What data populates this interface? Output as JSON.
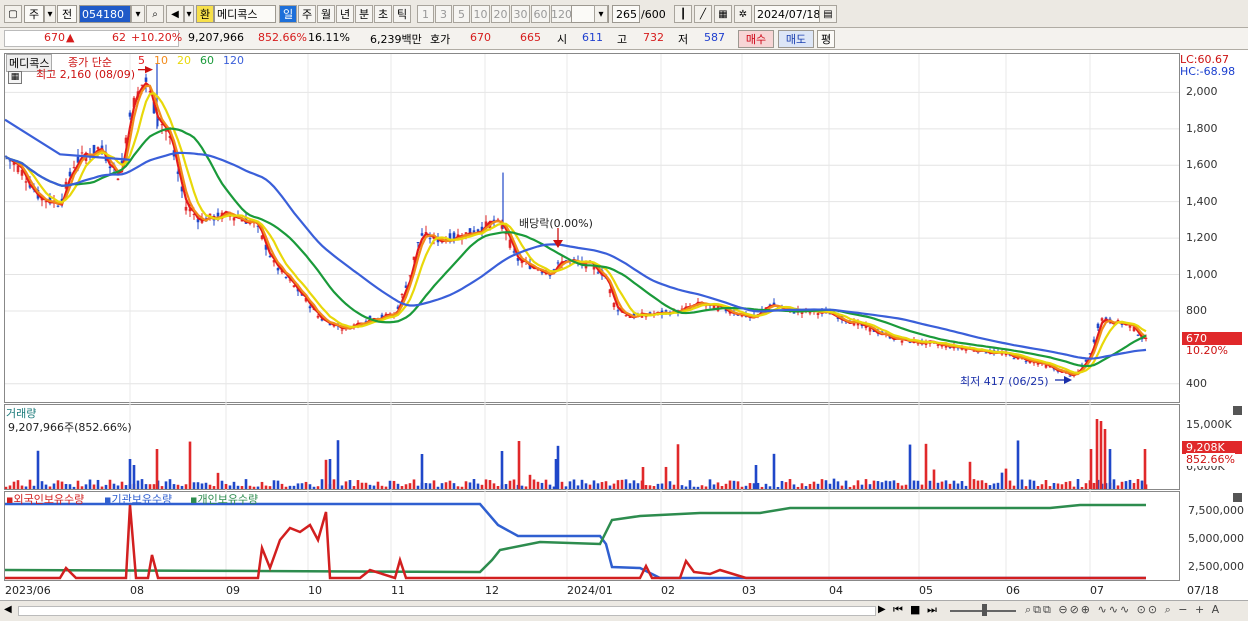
{
  "toolbar": {
    "chart_type_1": "주",
    "chart_type_2": "전",
    "code": "054180",
    "currency": "환",
    "stock_name": "메디콕스",
    "periods": [
      "일",
      "주",
      "월",
      "년",
      "분",
      "초",
      "틱"
    ],
    "selected_period": "일",
    "intervals": [
      "1",
      "3",
      "5",
      "10",
      "20",
      "30",
      "60",
      "120"
    ],
    "count": "265",
    "count_total": "/600",
    "date": "2024/07/18"
  },
  "quote": {
    "price": "670",
    "change_arrow": "▲",
    "change": "62",
    "change_pct": "+10.20%",
    "volume": "9,207,966",
    "volume_ratio": "852.66%",
    "turnover": "16.11%",
    "amount": "6,239백만",
    "hoga_label": "호가",
    "ask": "670",
    "bid": "665",
    "open_label": "시",
    "open": "611",
    "high_label": "고",
    "high": "732",
    "low_label": "저",
    "low": "587",
    "buy_label": "매수",
    "sell_label": "매도",
    "avg_label": "평"
  },
  "price_panel": {
    "stock_tag": "메디콕스",
    "ma_label": "종가 단순",
    "ma_periods": [
      "5",
      "10",
      "20",
      "60",
      "120"
    ],
    "ma_colors": [
      "#e31a1c",
      "#f28a1a",
      "#e8d80a",
      "#1a9a3a",
      "#3a5fd9"
    ],
    "high_note": "최고 2,160 (08/09)",
    "low_note": "최저 417 (06/25)",
    "dividend_note": "배당락(0.00%)",
    "lc": "LC:60.67",
    "hc": "HC:-68.98",
    "y_ticks": [
      "2,000",
      "1,800",
      "1,600",
      "1,400",
      "1,200",
      "1,000",
      "800",
      "400"
    ],
    "y_values": [
      2000,
      1800,
      1600,
      1400,
      1200,
      1000,
      800,
      400
    ],
    "current_price_tag": "670",
    "current_pct_tag": "10.20%"
  },
  "volume_panel": {
    "title": "거래량",
    "value": "9,207,966주(852.66%)",
    "y_ticks": [
      "15,000K",
      "6,000K"
    ],
    "current_tag": "9,208K",
    "current_pct": "852.66%"
  },
  "holding_panel": {
    "labels": [
      "외국인보유수량",
      "기관보유수량",
      "개인보유수량"
    ],
    "colors": [
      "#d21f1f",
      "#2f5fd0",
      "#2d8c4e"
    ],
    "y_ticks": [
      "7,500,000",
      "5,000,000",
      "2,500,000"
    ]
  },
  "x_axis": {
    "labels": [
      "2023/06",
      "08",
      "09",
      "10",
      "11",
      "12",
      "2024/01",
      "02",
      "03",
      "04",
      "05",
      "06",
      "07",
      "07/18"
    ]
  }
}
